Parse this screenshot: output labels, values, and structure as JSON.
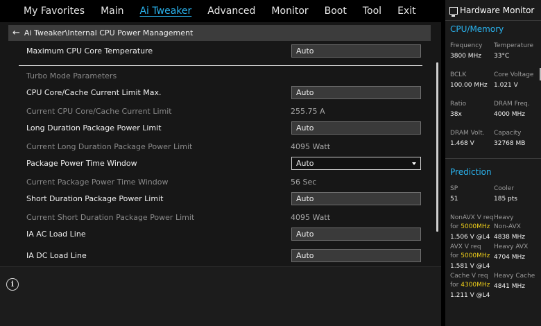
{
  "nav": {
    "tabs": [
      {
        "label": "My Favorites"
      },
      {
        "label": "Main"
      },
      {
        "label": "Ai Tweaker",
        "active": true
      },
      {
        "label": "Advanced"
      },
      {
        "label": "Monitor"
      },
      {
        "label": "Boot"
      },
      {
        "label": "Tool"
      },
      {
        "label": "Exit"
      }
    ]
  },
  "breadcrumb": {
    "back_icon": "arrow-left-icon",
    "path": "Ai Tweaker\\Internal CPU Power Management"
  },
  "settings": {
    "max_cpu_core_temp": {
      "label": "Maximum CPU Core Temperature",
      "value": "Auto"
    },
    "turbo_header": "Turbo Mode Parameters",
    "core_cache_limit_max": {
      "label": "CPU Core/Cache Current Limit Max.",
      "value": "Auto"
    },
    "current_core_cache_limit": {
      "label": "Current CPU Core/Cache Current Limit",
      "value": "255.75 A"
    },
    "long_duration_limit": {
      "label": "Long Duration Package Power Limit",
      "value": "Auto"
    },
    "current_long_duration_limit": {
      "label": "Current Long Duration Package Power Limit",
      "value": "4095 Watt"
    },
    "package_time_window": {
      "label": "Package Power Time Window",
      "value": "Auto"
    },
    "current_package_time_window": {
      "label": "Current Package Power Time Window",
      "value": "56 Sec"
    },
    "short_duration_limit": {
      "label": "Short Duration Package Power Limit",
      "value": "Auto"
    },
    "current_short_duration_limit": {
      "label": "Current Short Duration Package Power Limit",
      "value": "4095 Watt"
    },
    "ia_ac_load_line": {
      "label": "IA AC Load Line",
      "value": "Auto"
    },
    "ia_dc_load_line": {
      "label": "IA DC Load Line",
      "value": "Auto"
    }
  },
  "help": {
    "icon": "info-icon",
    "symbol": "i"
  },
  "hardware_monitor": {
    "title": "Hardware Monitor",
    "icon": "monitor-icon",
    "cpu_memory": {
      "section": "CPU/Memory",
      "frequency": {
        "label": "Frequency",
        "value": "3800 MHz"
      },
      "temperature": {
        "label": "Temperature",
        "value": "33°C"
      },
      "bclk": {
        "label": "BCLK",
        "value": "100.00 MHz"
      },
      "core_voltage": {
        "label": "Core Voltage",
        "value": "1.021 V"
      },
      "ratio": {
        "label": "Ratio",
        "value": "38x"
      },
      "dram_freq": {
        "label": "DRAM Freq.",
        "value": "4000 MHz"
      },
      "dram_volt": {
        "label": "DRAM Volt.",
        "value": "1.468 V"
      },
      "capacity": {
        "label": "Capacity",
        "value": "32768 MB"
      }
    },
    "prediction": {
      "section": "Prediction",
      "sp": {
        "label": "SP",
        "value": "51"
      },
      "cooler": {
        "label": "Cooler",
        "value": "185 pts"
      },
      "nonavx": {
        "label": "NonAVX V req",
        "for": "for",
        "freq": "5000MHz",
        "value": "1.506 V @L4"
      },
      "heavy_nonavx": {
        "label1": "Heavy",
        "label2": "Non-AVX",
        "value": "4838 MHz"
      },
      "avx": {
        "label": "AVX V req",
        "for": "for",
        "freq": "5000MHz",
        "value": "1.581 V @L4"
      },
      "heavy_avx": {
        "label": "Heavy AVX",
        "value": "4704 MHz"
      },
      "cache": {
        "label": "Cache V req",
        "for": "for",
        "freq": "4300MHz",
        "value": "1.211 V @L4"
      },
      "heavy_cache": {
        "label": "Heavy Cache",
        "value": "4841 MHz"
      }
    }
  },
  "colors": {
    "accent": "#2ab4f0",
    "highlight": "#f3d21a",
    "background": "#171717"
  }
}
